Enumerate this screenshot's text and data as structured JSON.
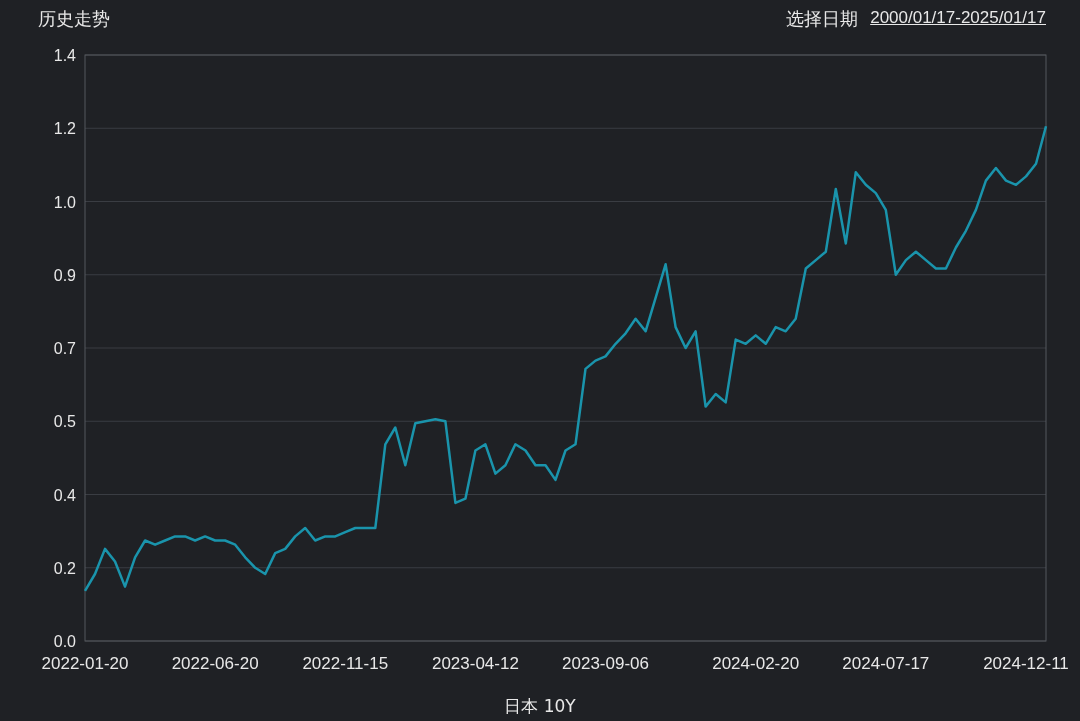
{
  "header": {
    "title": "历史走势",
    "date_label": "选择日期",
    "date_range": "2000/01/17-2025/01/17"
  },
  "chart": {
    "chart_data": {
      "type": "line",
      "grid": true,
      "ylim": [
        0,
        1.4
      ],
      "yticks": [
        {
          "value": 0,
          "label": "0.0"
        },
        {
          "value": 0.175,
          "label": "0.2"
        },
        {
          "value": 0.35,
          "label": "0.4"
        },
        {
          "value": 0.525,
          "label": "0.5"
        },
        {
          "value": 0.7,
          "label": "0.7"
        },
        {
          "value": 0.875,
          "label": "0.9"
        },
        {
          "value": 1.05,
          "label": "1.0"
        },
        {
          "value": 1.225,
          "label": "1.2"
        },
        {
          "value": 1.4,
          "label": "1.4"
        }
      ],
      "categories": [
        "2022-01-20",
        null,
        null,
        null,
        null,
        null,
        null,
        null,
        null,
        null,
        null,
        null,
        null,
        "2022-06-20",
        null,
        null,
        null,
        null,
        null,
        null,
        null,
        null,
        null,
        null,
        null,
        null,
        "2022-11-15",
        null,
        null,
        null,
        null,
        null,
        null,
        null,
        null,
        null,
        null,
        null,
        null,
        "2023-04-12",
        null,
        null,
        null,
        null,
        null,
        null,
        null,
        null,
        null,
        null,
        null,
        null,
        "2023-09-06",
        null,
        null,
        null,
        null,
        null,
        null,
        null,
        null,
        null,
        null,
        null,
        null,
        null,
        null,
        "2024-02-20",
        null,
        null,
        null,
        null,
        null,
        null,
        null,
        null,
        null,
        null,
        null,
        null,
        "2024-07-17",
        null,
        null,
        null,
        null,
        null,
        null,
        null,
        null,
        null,
        null,
        null,
        null,
        null,
        "2024-12-11",
        null,
        null
      ],
      "series": [
        {
          "name": "日本 10Y",
          "color": "#1a94ac",
          "values": [
            0.12,
            0.16,
            0.22,
            0.19,
            0.13,
            0.2,
            0.24,
            0.23,
            0.24,
            0.25,
            0.25,
            0.24,
            0.25,
            0.24,
            0.24,
            0.23,
            0.2,
            0.175,
            0.16,
            0.21,
            0.22,
            0.25,
            0.27,
            0.24,
            0.25,
            0.25,
            0.26,
            0.27,
            0.27,
            0.27,
            0.47,
            0.51,
            0.42,
            0.52,
            0.525,
            0.53,
            0.525,
            0.33,
            0.34,
            0.455,
            0.47,
            0.4,
            0.42,
            0.47,
            0.455,
            0.42,
            0.42,
            0.385,
            0.455,
            0.47,
            0.65,
            0.67,
            0.68,
            0.71,
            0.735,
            0.77,
            0.74,
            0.82,
            0.9,
            0.75,
            0.7,
            0.74,
            0.56,
            0.59,
            0.57,
            0.72,
            0.71,
            0.73,
            0.71,
            0.75,
            0.74,
            0.77,
            0.89,
            0.91,
            0.93,
            1.08,
            0.95,
            1.12,
            1.09,
            1.07,
            1.03,
            0.875,
            0.91,
            0.93,
            0.91,
            0.89,
            0.89,
            0.94,
            0.98,
            1.03,
            1.1,
            1.13,
            1.1,
            1.09,
            1.11,
            1.14,
            1.23
          ]
        }
      ]
    }
  }
}
